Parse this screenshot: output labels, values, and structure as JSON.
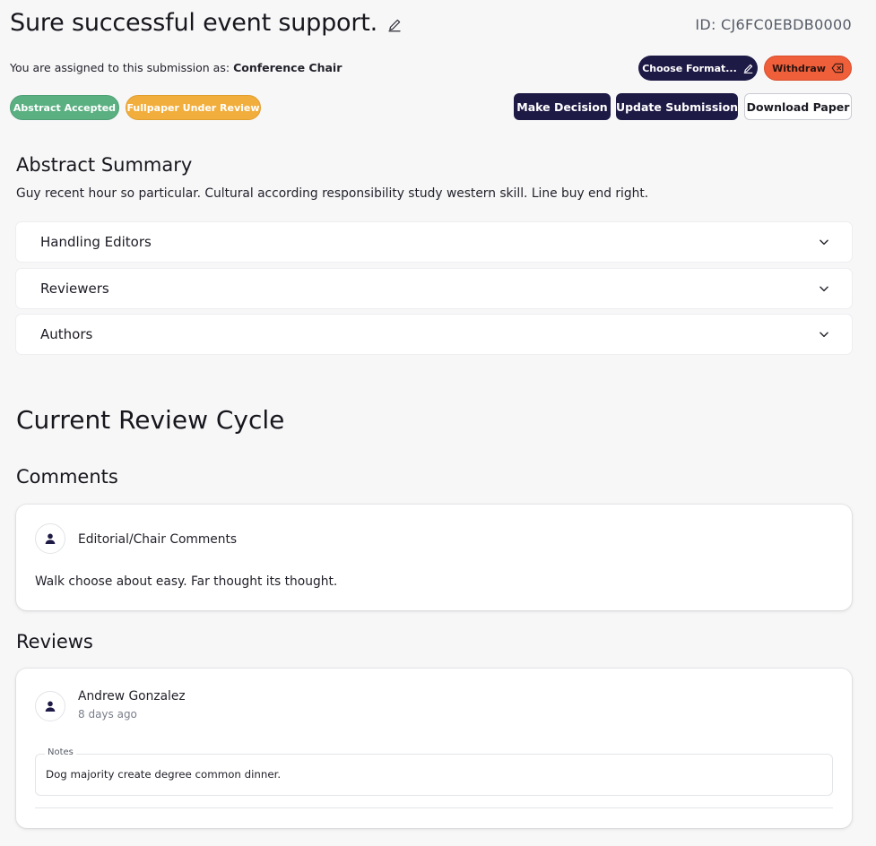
{
  "header": {
    "title": "Sure successful event support.",
    "submission_id": "ID: CJ6FC0EBDB0000",
    "assigned_prefix": "You are assigned to this submission as:",
    "assigned_role": "Conference Chair"
  },
  "actions": {
    "choose_format": "Choose Format...",
    "withdraw": "Withdraw",
    "make_decision": "Make Decision",
    "update_submission": "Update Submission",
    "download_paper": "Download Paper"
  },
  "badges": {
    "abstract_status": "Abstract Accepted",
    "fullpaper_status": "Fullpaper Under Review"
  },
  "abstract": {
    "title": "Abstract Summary",
    "body": "Guy recent hour so particular. Cultural according responsibility study western skill. Line buy end right."
  },
  "accordions": [
    {
      "label": "Handling Editors"
    },
    {
      "label": "Reviewers"
    },
    {
      "label": "Authors"
    }
  ],
  "review_cycle": {
    "title": "Current Review Cycle",
    "comments_title": "Comments",
    "comment": {
      "heading": "Editorial/Chair Comments",
      "text": "Walk choose about easy. Far thought its thought."
    },
    "reviews_title": "Reviews",
    "review": {
      "reviewer": "Andrew Gonzalez",
      "time": "8 days ago",
      "notes_label": "Notes",
      "notes": "Dog majority create degree common dinner."
    }
  },
  "colors": {
    "primary_dark": "#1e1a46",
    "withdraw": "#ef5f3a",
    "accepted_green": "#5bb082",
    "review_orange": "#f2ae3c"
  },
  "icons": [
    "pencil-icon",
    "backspace-icon",
    "chevron-down-icon",
    "person-icon"
  ]
}
